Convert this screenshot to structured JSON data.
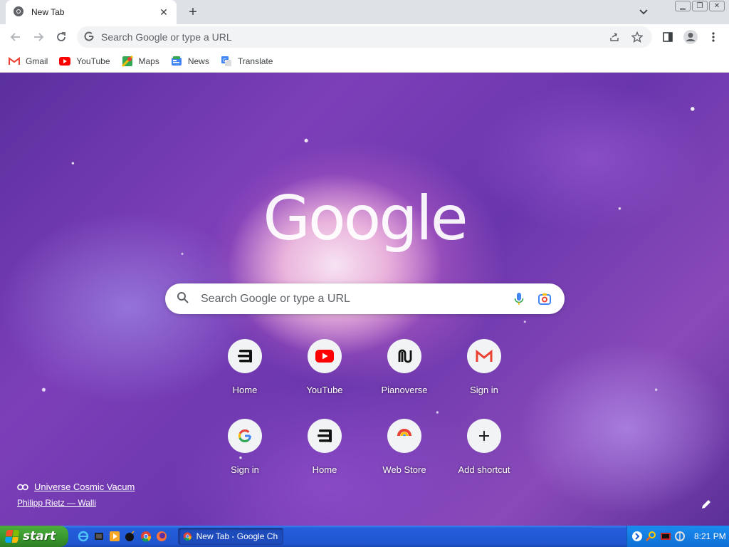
{
  "browser": {
    "tab_title": "New Tab",
    "omnibox_placeholder": "Search Google or type a URL"
  },
  "bookmarks": [
    {
      "label": "Gmail",
      "icon": "gmail-icon"
    },
    {
      "label": "YouTube",
      "icon": "youtube-icon"
    },
    {
      "label": "Maps",
      "icon": "maps-icon"
    },
    {
      "label": "News",
      "icon": "news-icon"
    },
    {
      "label": "Translate",
      "icon": "translate-icon"
    }
  ],
  "ntp": {
    "logo_text": "Google",
    "search_placeholder": "Search Google or type a URL",
    "shortcuts": [
      {
        "label": "Home",
        "icon": "home-icon"
      },
      {
        "label": "YouTube",
        "icon": "youtube-icon"
      },
      {
        "label": "Pianoverse",
        "icon": "pianoverse-icon"
      },
      {
        "label": "Sign in",
        "icon": "gmail-icon"
      },
      {
        "label": "Sign in",
        "icon": "google-icon"
      },
      {
        "label": "Home",
        "icon": "home-icon"
      },
      {
        "label": "Web Store",
        "icon": "webstore-icon"
      },
      {
        "label": "Add shortcut",
        "icon": "plus-icon"
      }
    ],
    "attribution_title": "Universe Cosmic Vacum",
    "attribution_author": "Philipp Rietz — Walli"
  },
  "taskbar": {
    "start_label": "start",
    "task_label": "New Tab - Google Chr...",
    "clock": "8:21 PM"
  },
  "colors": {
    "accent_blue": "#1a73e8",
    "xp_taskbar": "#245edb",
    "xp_start": "#3a9a2e"
  }
}
